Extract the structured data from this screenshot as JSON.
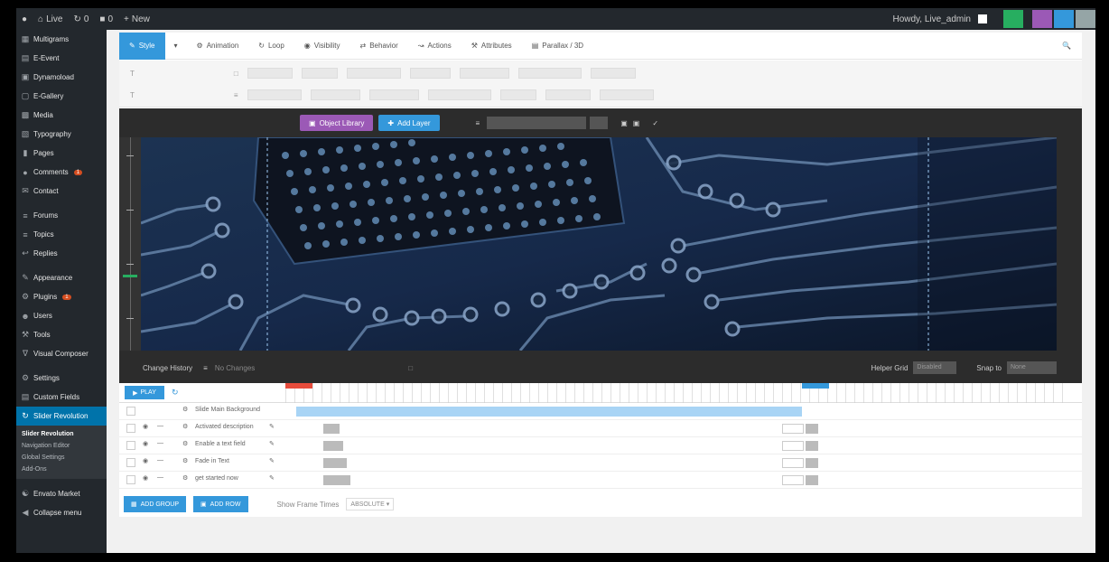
{
  "adminbar": {
    "site_name": "Live",
    "updates": "0",
    "comments": "0",
    "new_label": "New",
    "howdy": "Howdy, Live_admin"
  },
  "sidebar": {
    "items": [
      {
        "label": "Multigrams",
        "icon": "grid-icon"
      },
      {
        "label": "E-Event",
        "icon": "calendar-icon"
      },
      {
        "label": "Dynamoload",
        "icon": "gallery-icon"
      },
      {
        "label": "E-Gallery",
        "icon": "image-icon"
      },
      {
        "label": "Media",
        "icon": "media-icon"
      },
      {
        "label": "Typography",
        "icon": "typography-icon"
      },
      {
        "label": "Pages",
        "icon": "page-icon"
      },
      {
        "label": "Comments",
        "icon": "comment-icon",
        "badge": "1"
      },
      {
        "label": "Contact",
        "icon": "mail-icon"
      },
      {
        "label": "Forums",
        "icon": "forum-icon"
      },
      {
        "label": "Topics",
        "icon": "topic-icon"
      },
      {
        "label": "Replies",
        "icon": "reply-icon"
      },
      {
        "label": "Appearance",
        "icon": "brush-icon"
      },
      {
        "label": "Plugins",
        "icon": "plugin-icon",
        "badge": "1"
      },
      {
        "label": "Users",
        "icon": "user-icon"
      },
      {
        "label": "Tools",
        "icon": "tool-icon"
      },
      {
        "label": "Visual Composer",
        "icon": "vc-icon"
      },
      {
        "label": "Settings",
        "icon": "settings-icon"
      },
      {
        "label": "Custom Fields",
        "icon": "fields-icon"
      },
      {
        "label": "Slider Revolution",
        "icon": "revolution-icon"
      }
    ],
    "submenu": [
      "Slider Revolution",
      "Navigation Editor",
      "Global Settings",
      "Add-Ons"
    ],
    "bottom": [
      {
        "label": "Envato Market",
        "icon": "envato-icon"
      },
      {
        "label": "Collapse menu",
        "icon": "collapse-icon"
      }
    ]
  },
  "topnav": {
    "tabs": [
      {
        "label": "Style",
        "icon": "style-icon"
      },
      {
        "label": "Animation",
        "icon": "animation-icon"
      },
      {
        "label": "Loop",
        "icon": "loop-icon"
      },
      {
        "label": "Visibility",
        "icon": "eye-icon"
      },
      {
        "label": "Behavior",
        "icon": "behavior-icon"
      },
      {
        "label": "Actions",
        "icon": "action-icon"
      },
      {
        "label": "Attributes",
        "icon": "attribute-icon"
      },
      {
        "label": "Parallax / 3D",
        "icon": "parallax-icon"
      }
    ]
  },
  "stage": {
    "object_library": "Object Library",
    "add_layer": "Add Layer",
    "change_history": "Change History",
    "no_changes": "No Changes",
    "helper_grid": "Helper Grid",
    "helper_value": "Disabled",
    "snap_to": "Snap to",
    "snap_value": "None"
  },
  "timeline": {
    "play": "PLAY",
    "bg_layer": "Slide Main Background",
    "rows": [
      "Activated description",
      "Enable a text field",
      "Fade in Text",
      "get started now"
    ],
    "add_group": "ADD GROUP",
    "add_row": "ADD ROW",
    "show_frame_times": "Show Frame Times",
    "frame_value": "ABSOLUTE"
  },
  "colors": {
    "accent": "#3498db",
    "purple": "#9b59b6",
    "sidebar": "#23282d"
  }
}
